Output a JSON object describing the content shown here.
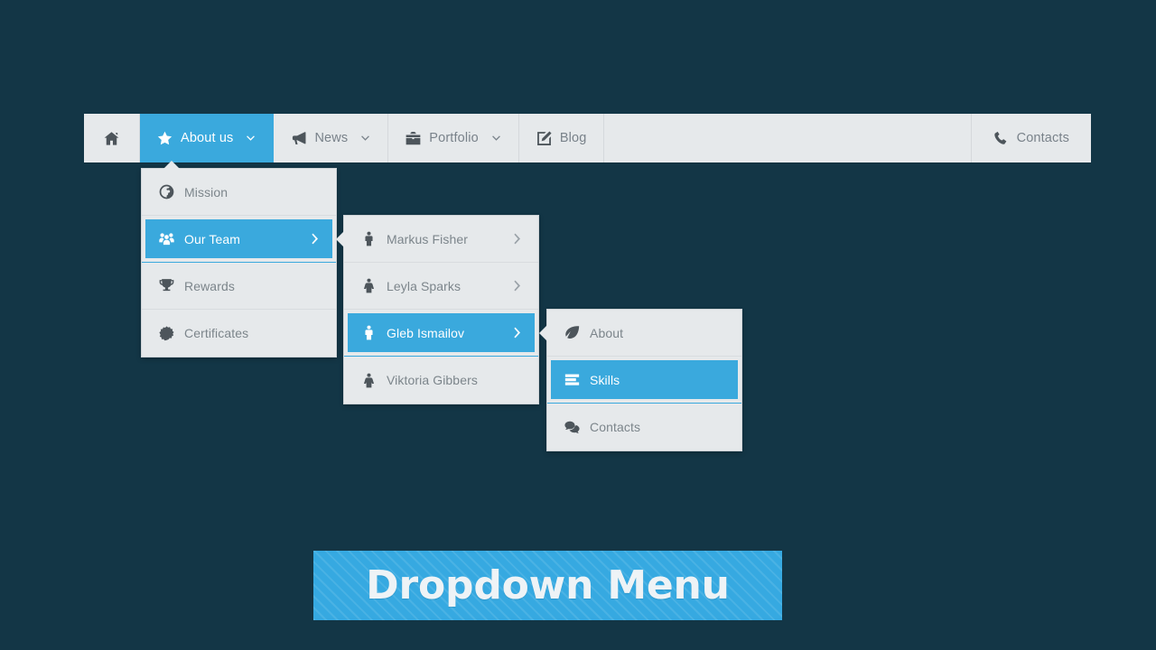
{
  "page": {
    "background_color": "#133646",
    "accent_color": "#3aa9dd",
    "panel_color": "#e6e9eb",
    "text_color": "#7c858b"
  },
  "navbar": {
    "items": [
      {
        "label": "",
        "icon": "home-icon",
        "active": false,
        "has_caret": false
      },
      {
        "label": "About us",
        "icon": "star-icon",
        "active": true,
        "has_caret": true
      },
      {
        "label": "News",
        "icon": "megaphone-icon",
        "active": false,
        "has_caret": true
      },
      {
        "label": "Portfolio",
        "icon": "briefcase-icon",
        "active": false,
        "has_caret": true
      },
      {
        "label": "Blog",
        "icon": "edit-square-icon",
        "active": false,
        "has_caret": false
      }
    ],
    "right_item": {
      "label": "Contacts",
      "icon": "phone-icon"
    }
  },
  "dropdown_level1": {
    "items": [
      {
        "label": "Mission",
        "icon": "globe-icon",
        "selected": false,
        "has_submenu": false
      },
      {
        "label": "Our Team",
        "icon": "users-group-icon",
        "selected": true,
        "has_submenu": true
      },
      {
        "label": "Rewards",
        "icon": "trophy-icon",
        "selected": false,
        "has_submenu": false
      },
      {
        "label": "Certificates",
        "icon": "certificate-badge-icon",
        "selected": false,
        "has_submenu": false
      }
    ]
  },
  "dropdown_level2": {
    "items": [
      {
        "label": "Markus Fisher",
        "icon": "male-icon",
        "selected": false,
        "has_submenu": true
      },
      {
        "label": "Leyla Sparks",
        "icon": "female-icon",
        "selected": false,
        "has_submenu": true
      },
      {
        "label": "Gleb Ismailov",
        "icon": "male-icon",
        "selected": true,
        "has_submenu": true
      },
      {
        "label": "Viktoria Gibbers",
        "icon": "female-icon",
        "selected": false,
        "has_submenu": false
      }
    ]
  },
  "dropdown_level3": {
    "items": [
      {
        "label": "About",
        "icon": "leaf-icon",
        "selected": false,
        "has_submenu": false
      },
      {
        "label": "Skills",
        "icon": "bars-list-icon",
        "selected": true,
        "has_submenu": false
      },
      {
        "label": "Contacts",
        "icon": "comments-icon",
        "selected": false,
        "has_submenu": false
      }
    ]
  },
  "banner": {
    "text": "Dropdown Menu",
    "color": "#36a9e1"
  }
}
